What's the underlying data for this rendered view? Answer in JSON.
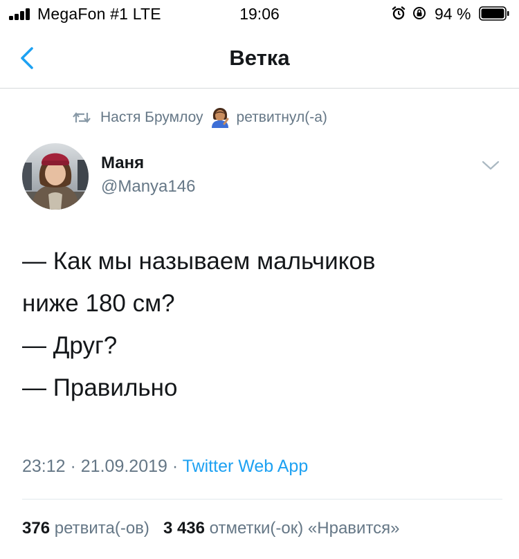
{
  "status_bar": {
    "carrier": "MegaFon #1 LTE",
    "time": "19:06",
    "battery": "94 %",
    "icons": [
      "signal-icon",
      "alarm-icon",
      "rotation-lock-icon",
      "battery-icon"
    ]
  },
  "header": {
    "back_icon": "chevron-left-icon",
    "title": "Ветка"
  },
  "retweet_context": {
    "icon": "retweet-icon",
    "name": "Настя Брумлоу",
    "emoji": "person-tipping-hand-emoji",
    "action": "ретвитнул(-а)"
  },
  "tweet": {
    "author_name": "Маня",
    "author_handle": "@Manya146",
    "menu_icon": "chevron-down-icon",
    "lines": [
      "— Как мы называем мальчиков",
      "ниже 180 см?",
      "— Друг?",
      "— Правильно"
    ],
    "meta": {
      "time": "23:12",
      "separator": " · ",
      "date": "21.09.2019",
      "source": "Twitter Web App"
    },
    "stats": {
      "retweets_count": "376",
      "retweets_label": "ретвита(-ов)",
      "likes_count": "3 436",
      "likes_label": "отметки(-ок) «Нравится»"
    }
  },
  "colors": {
    "accent": "#1da1f2",
    "secondary_text": "#657786",
    "primary_text": "#14171a",
    "divider": "#e1e8ed"
  }
}
